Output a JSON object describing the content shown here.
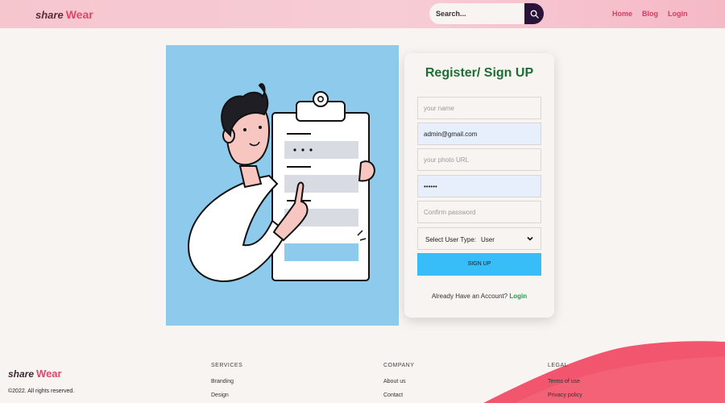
{
  "header": {
    "logo": {
      "part1": "share",
      "part2": "Wear"
    },
    "search": {
      "placeholder": "Search..."
    },
    "nav": [
      "Home",
      "Blog",
      "Login"
    ]
  },
  "form": {
    "title": "Register/ Sign UP",
    "name_placeholder": "your name",
    "email_value": "admin@gmail.com",
    "photo_placeholder": "your photo URL",
    "password_value": "••••••",
    "confirm_placeholder": "Confirm password",
    "user_type_label": "Select User Type:",
    "user_type_value": "User",
    "submit_label": "SIGN UP",
    "account_text": "Already Have an Account?",
    "login_link": "Login"
  },
  "footer": {
    "logo": {
      "part1": "share",
      "part2": "Wear"
    },
    "copyright": "©2022. All rights reserved.",
    "services": {
      "heading": "SERVICES",
      "links": [
        "Branding",
        "Design"
      ]
    },
    "company": {
      "heading": "COMPANY",
      "links": [
        "About us",
        "Contact"
      ]
    },
    "legal": {
      "heading": "LEGAL",
      "links": [
        "Terms of use",
        "Privacy policy"
      ]
    }
  },
  "colors": {
    "header_pink": "#f6c6cf",
    "accent_pink": "#e0476a",
    "title_green": "#1e6e34",
    "button_blue": "#38bdf8",
    "illustration_bg": "#8ecaec",
    "footer_swoosh": "#f2566f"
  }
}
